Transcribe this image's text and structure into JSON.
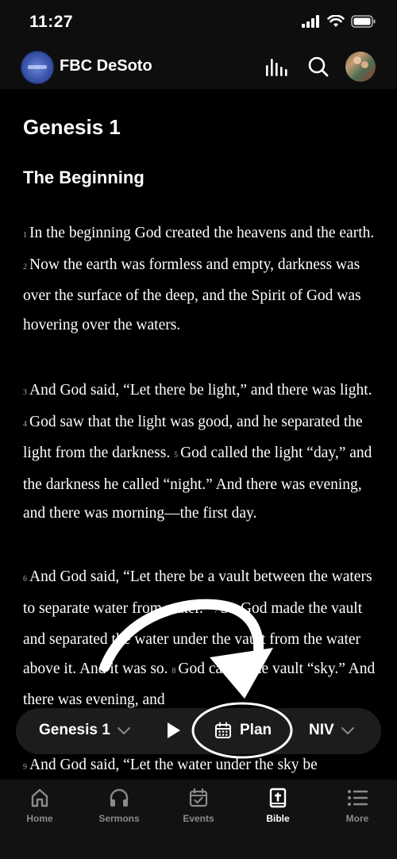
{
  "status": {
    "time": "11:27"
  },
  "header": {
    "title": "FBC DeSoto"
  },
  "reader": {
    "chapter_title": "Genesis 1",
    "section_title": "The Beginning",
    "paragraphs": [
      {
        "segments": [
          {
            "num": "1",
            "text": "In the beginning God created the heavens and the earth."
          },
          {
            "num": "2",
            "text": "Now the earth was formless and empty, darkness was over the surface of the deep, and the Spirit of God was hovering over the waters."
          }
        ]
      },
      {
        "segments": [
          {
            "num": "3",
            "text": "And God said, “Let there be light,” and there was light."
          },
          {
            "num": "4",
            "text": "God saw that the light was good, and he separated the light from the darkness."
          },
          {
            "num": "5",
            "text": "God called the light “day,” and the darkness he called “night.” And there was evening, and there was morning—the first day."
          }
        ]
      },
      {
        "segments": [
          {
            "num": "6",
            "text": "And God said, “Let there be a vault between the waters to separate water from water.”"
          },
          {
            "num": "7",
            "text": "So God made the vault and separated the water under the vault from the water above it. And it was so."
          },
          {
            "num": "8",
            "text": "God called the vault “sky.” And there was evening, and"
          }
        ]
      },
      {
        "segments": [
          {
            "num": "9",
            "text": "And God said, “Let the water under the sky be"
          }
        ]
      }
    ]
  },
  "player": {
    "book_label": "Genesis 1",
    "plan_label": "Plan",
    "version_label": "NIV"
  },
  "tabs": [
    {
      "label": "Home",
      "icon": "home-icon"
    },
    {
      "label": "Sermons",
      "icon": "headphones-icon"
    },
    {
      "label": "Events",
      "icon": "calendar-check-icon"
    },
    {
      "label": "Bible",
      "icon": "bible-icon",
      "active": true
    },
    {
      "label": "More",
      "icon": "menu-list-icon"
    }
  ],
  "colors": {
    "background": "#000000",
    "bar": "#1c1c1c",
    "tab_inactive": "#8a8a8a",
    "text": "#ffffff"
  }
}
